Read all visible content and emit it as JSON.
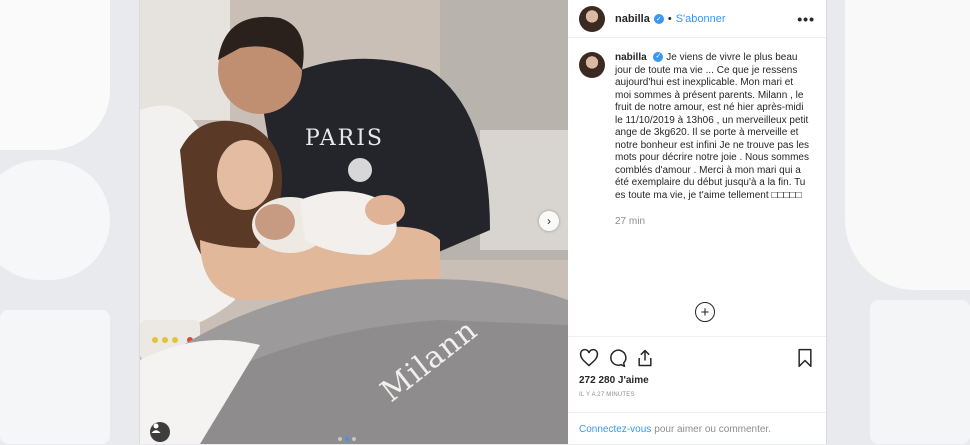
{
  "post": {
    "username": "nabilla",
    "separator": "•",
    "follow_label": "S'abonner",
    "more_icon": "•••",
    "caption": "Je viens de vivre le plus beau jour de toute ma vie ... Ce que je ressens aujourd'hui est inexplicable. Mon mari et moi sommes à présent parents. Milann , le fruit de notre amour, est né hier après-midi le 11/10/2019 à 13h06 , un merveilleux petit ange de 3kg620. Il se porte à merveille et notre bonheur est infini Je ne trouve pas les mots pour décrire notre joie . Nous sommes comblés d'amour . Merci à mon mari qui a été exemplaire du début jusqu'à a la fin. Tu es toute ma vie, je t'aime tellement □□□□□",
    "time_ago": "27 min",
    "likes": "272 280 J'aime",
    "timestamp": "IL Y A 27 MINUTES",
    "login_link": "Connectez-vous",
    "login_text": "pour aimer ou commenter.",
    "blanket_text": "Milann"
  },
  "icons": {
    "verified": "verified-badge-icon",
    "heart": "heart-icon",
    "comment": "comment-icon",
    "share": "share-icon",
    "save": "bookmark-icon",
    "add": "plus-circle-icon",
    "next": "chevron-right-icon",
    "tag": "user-tag-icon"
  },
  "colors": {
    "accent": "#3897f0",
    "text": "#262626",
    "muted": "#8e8e8e"
  },
  "carousel": {
    "active_index": 1,
    "count": 3
  }
}
